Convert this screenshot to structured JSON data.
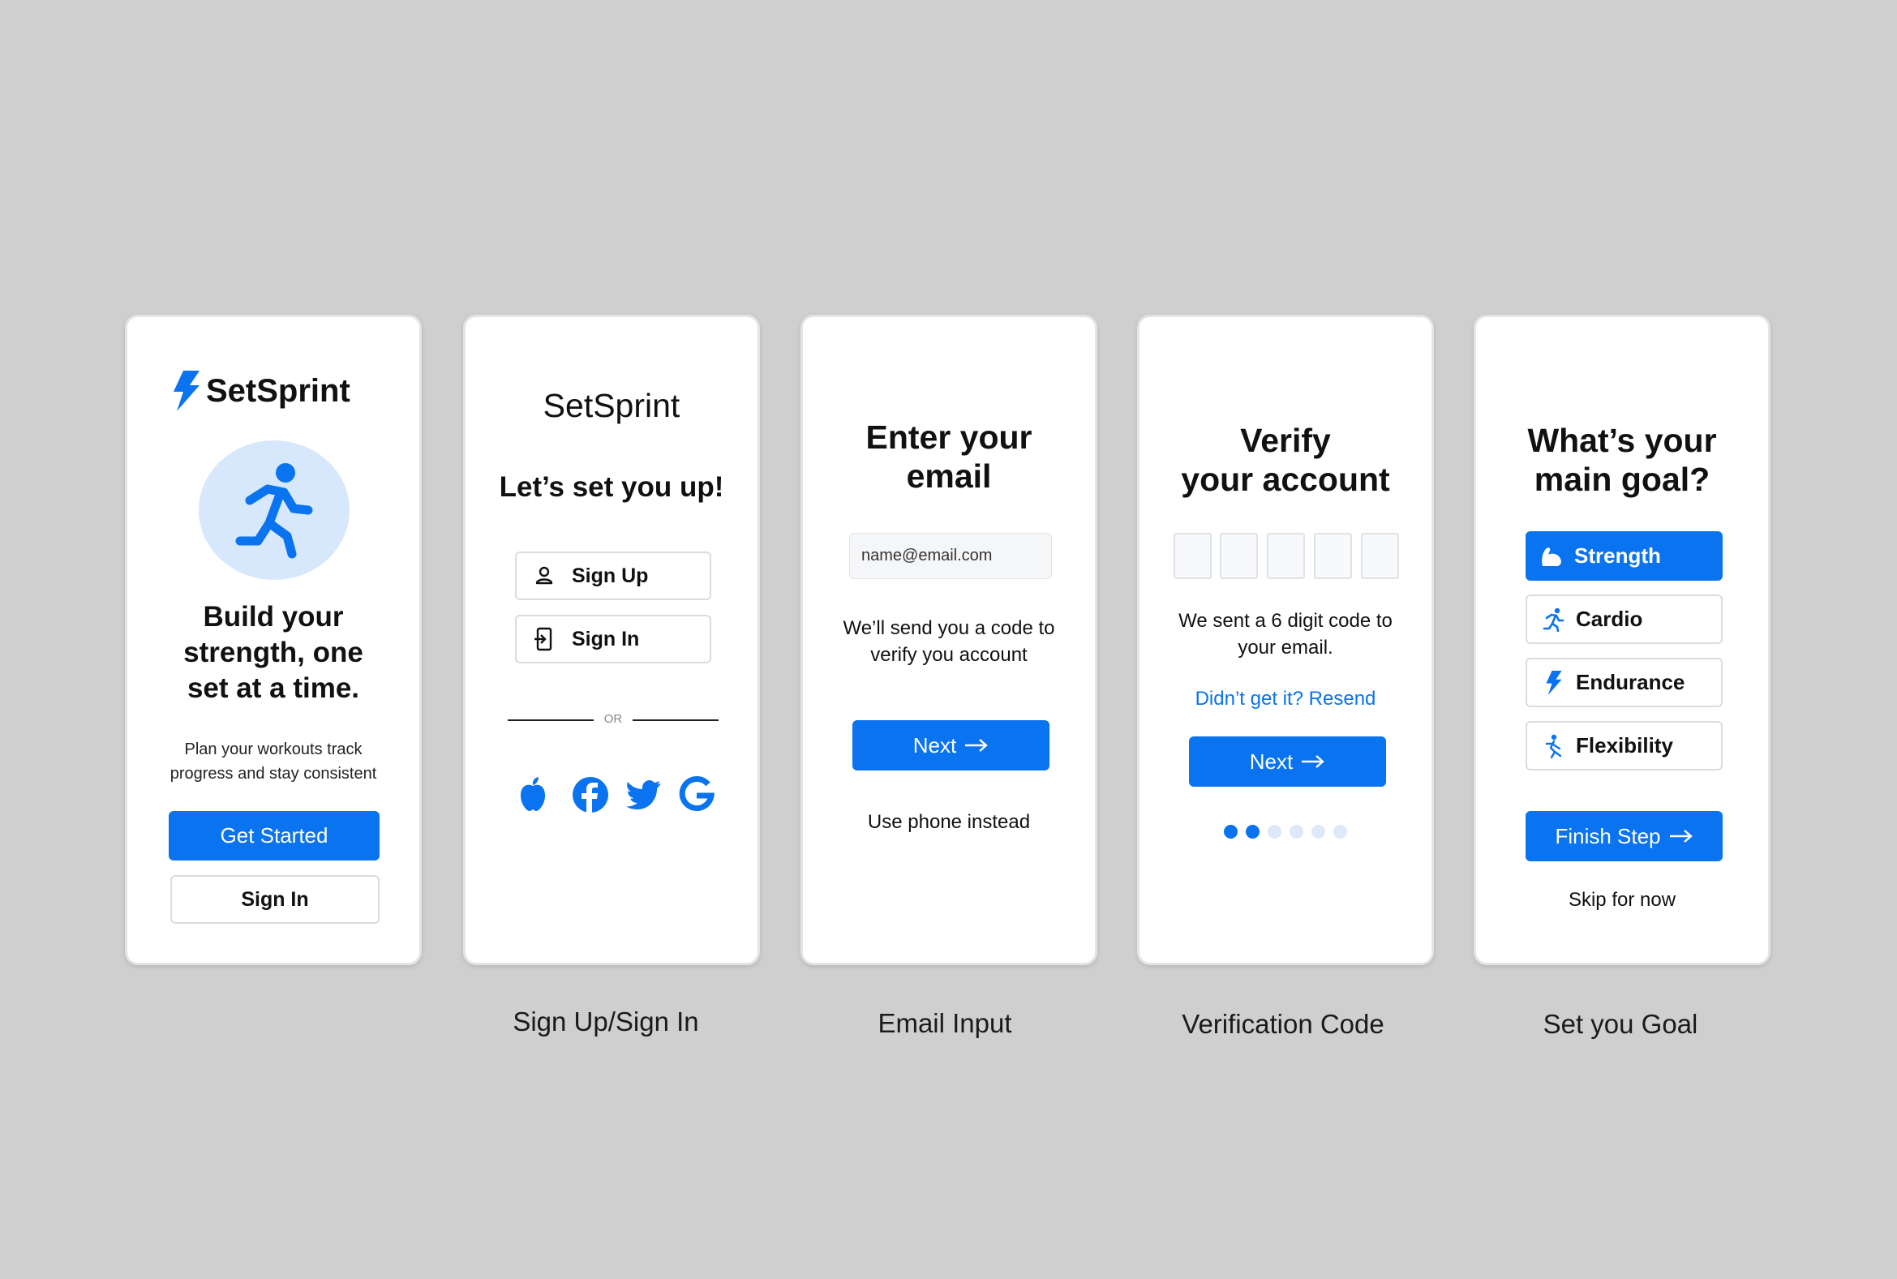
{
  "colors": {
    "background": "#cfcfcf",
    "accent": "#0a73f0",
    "light_accent": "#d7e8fd"
  },
  "screen1": {
    "brand": "SetSprint",
    "headline_lines": [
      "Build your",
      "strength, one",
      "set at a time."
    ],
    "subtitle_lines": [
      "Plan your workouts track",
      "progress and stay consistent"
    ],
    "primary_button": "Get Started",
    "secondary_button": "Sign In"
  },
  "screen2": {
    "brand": "SetSprint",
    "heading": "Let’s set you up!",
    "sign_up": "Sign Up",
    "sign_in": "Sign In",
    "divider": "OR",
    "social_icons": [
      "apple-icon",
      "facebook-icon",
      "twitter-icon",
      "google-icon"
    ]
  },
  "screen3": {
    "heading_lines": [
      "Enter your",
      "email"
    ],
    "email_placeholder": "name@email.com",
    "info_lines": [
      "We’ll send you a code to",
      "verify you account"
    ],
    "next_button": "Next",
    "alt_link": "Use phone instead"
  },
  "screen4": {
    "heading_lines": [
      "Verify",
      "your account"
    ],
    "info_lines": [
      "We sent a 6 digit code to",
      "your email."
    ],
    "resend_link": "Didn’t get it? Resend",
    "next_button": "Next",
    "code_boxes": 5,
    "progress": {
      "current_step": 2,
      "total_steps": 6
    }
  },
  "screen5": {
    "heading_lines": [
      "What’s your",
      "main goal?"
    ],
    "goals": [
      {
        "label": "Strength",
        "icon": "flexed-arm-icon",
        "selected": true
      },
      {
        "label": "Cardio",
        "icon": "runner-icon",
        "selected": false
      },
      {
        "label": "Endurance",
        "icon": "lightning-icon",
        "selected": false
      },
      {
        "label": "Flexibility",
        "icon": "stretch-icon",
        "selected": false
      }
    ],
    "finish_button": "Finish Step",
    "skip_link": "Skip for now"
  },
  "captions": [
    "Sign Up/Sign In",
    "Email Input",
    "Verification Code",
    "Set you Goal"
  ]
}
